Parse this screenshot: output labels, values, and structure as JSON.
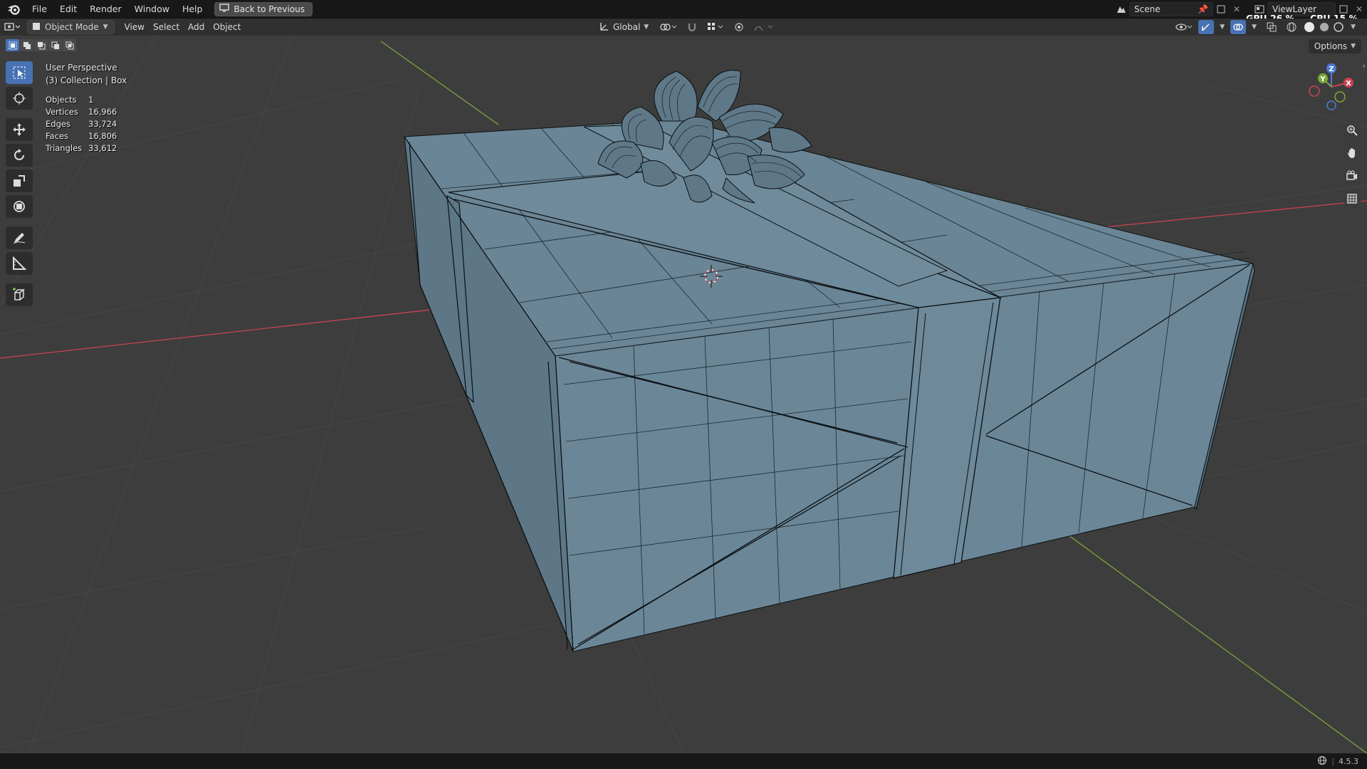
{
  "menubar": {
    "items": [
      "File",
      "Edit",
      "Render",
      "Window",
      "Help"
    ],
    "back_button": "Back to Previous",
    "scene_name": "Scene",
    "view_layer": "ViewLayer",
    "gpu_label": "GPU",
    "gpu_value": "26 %",
    "cpu_label": "CPU",
    "cpu_value": "15 %"
  },
  "header": {
    "mode": "Object Mode",
    "menus": [
      "View",
      "Select",
      "Add",
      "Object"
    ],
    "orientation": "Global"
  },
  "viewport": {
    "perspective": "User Perspective",
    "collection": "(3) Collection | Box",
    "options": "Options",
    "stats": [
      {
        "label": "Objects",
        "value": "1"
      },
      {
        "label": "Vertices",
        "value": "16,966"
      },
      {
        "label": "Edges",
        "value": "33,724"
      },
      {
        "label": "Faces",
        "value": "16,806"
      },
      {
        "label": "Triangles",
        "value": "33,612"
      }
    ],
    "gizmo_axes": {
      "x": "X",
      "y": "Y",
      "z": "Z"
    }
  },
  "statusbar": {
    "version": "4.5.3"
  },
  "colors": {
    "accent": "#4772b3",
    "viewport_bg": "#3d3d3d",
    "box_fill": "#6a8595",
    "wire": "#0b0f12",
    "x_axis": "#c84250",
    "y_axis": "#7aa73a"
  }
}
